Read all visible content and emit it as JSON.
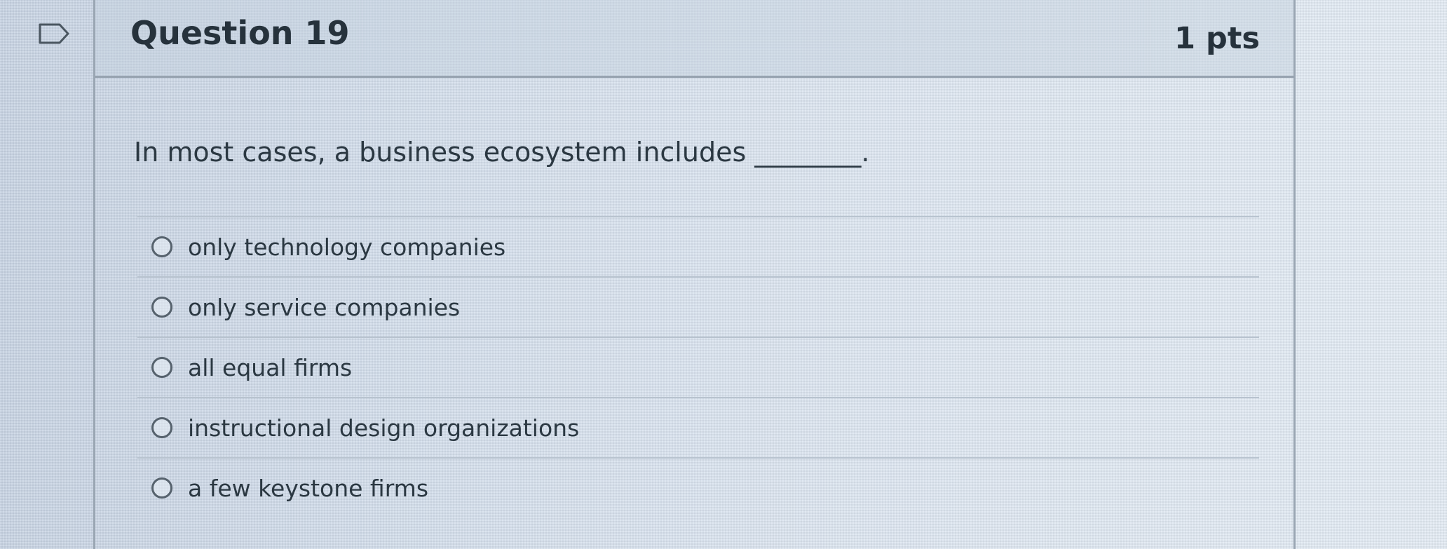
{
  "question": {
    "title": "Question 19",
    "points": "1 pts",
    "text": "In most cases, a business ecosystem includes ________."
  },
  "answers": [
    {
      "label": "only technology companies",
      "selected": false
    },
    {
      "label": "only service companies",
      "selected": false
    },
    {
      "label": "all equal firms",
      "selected": false
    },
    {
      "label": "instructional design organizations",
      "selected": false
    },
    {
      "label": "a few keystone firms",
      "selected": false
    }
  ],
  "icons": {
    "flag": "flag-question-icon"
  }
}
